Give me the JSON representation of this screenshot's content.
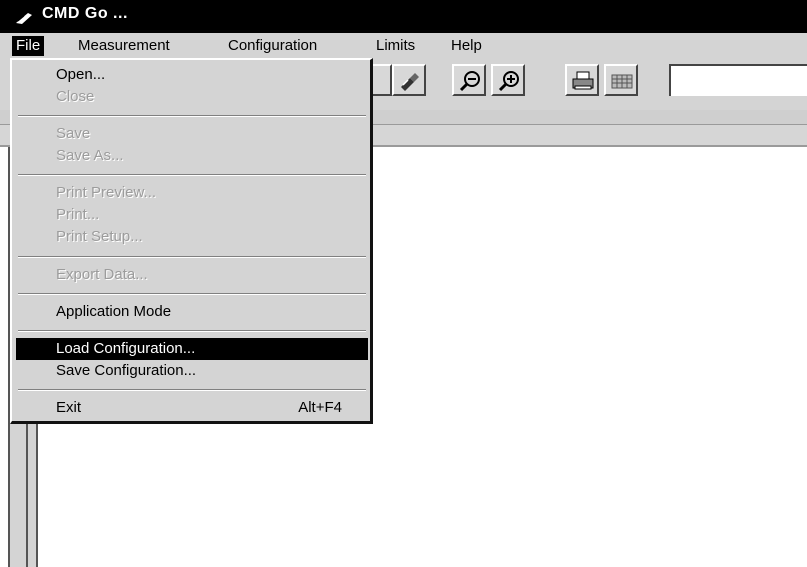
{
  "window": {
    "title": "CMD Go ..."
  },
  "menubar": {
    "items": [
      {
        "label": "File",
        "active": true
      },
      {
        "label": "Measurement"
      },
      {
        "label": "Configuration"
      },
      {
        "label": "Limits"
      },
      {
        "label": "Help"
      }
    ]
  },
  "toolbar": {
    "buttons": [
      "connect-icon",
      "zoom-out-icon",
      "zoom-in-icon",
      "print-icon",
      "grid-icon"
    ]
  },
  "file_menu": {
    "open": "Open...",
    "close": "Close",
    "save": "Save",
    "save_as": "Save As...",
    "print_preview": "Print Preview...",
    "print": "Print...",
    "print_setup": "Print Setup...",
    "export_data": "Export Data...",
    "application_mode": "Application Mode",
    "load_configuration": "Load Configuration...",
    "save_configuration": "Save Configuration...",
    "exit": "Exit",
    "exit_shortcut": "Alt+F4"
  }
}
